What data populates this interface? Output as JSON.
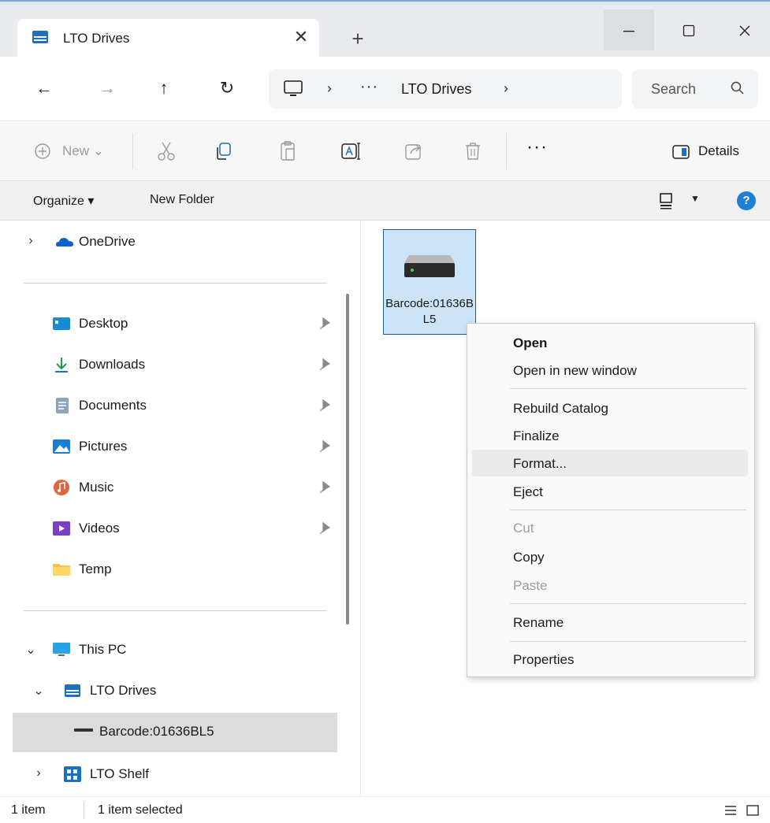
{
  "window": {
    "tab_title": "LTO Drives",
    "tab_close": "✕",
    "new_tab": "+",
    "minimize": "—",
    "maximize": "☐",
    "close": "✕"
  },
  "nav": {
    "back": "←",
    "forward": "→",
    "up": "↑",
    "refresh": "↻",
    "breadcrumb_sep": "›",
    "breadcrumb_overflow": "···",
    "breadcrumb_current": "LTO Drives",
    "search_placeholder": "Search"
  },
  "command_bar": {
    "new_label": "New ⌄",
    "more": "···",
    "details_label": "Details"
  },
  "organize_bar": {
    "organize_label": "Organize ▾",
    "new_folder_label": "New Folder",
    "view_caret": "▼",
    "help": "?"
  },
  "sidebar": {
    "onedrive": "OneDrive",
    "quick_access": [
      {
        "label": "Desktop",
        "icon": "desktop-icon"
      },
      {
        "label": "Downloads",
        "icon": "downloads-icon"
      },
      {
        "label": "Documents",
        "icon": "documents-icon"
      },
      {
        "label": "Pictures",
        "icon": "pictures-icon"
      },
      {
        "label": "Music",
        "icon": "music-icon"
      },
      {
        "label": "Videos",
        "icon": "videos-icon"
      },
      {
        "label": "Temp",
        "icon": "folder-icon"
      }
    ],
    "this_pc": "This PC",
    "lto_drives": "LTO Drives",
    "barcode_item": "Barcode:01636BL5",
    "lto_shelf": "LTO Shelf",
    "chevron_right": "›",
    "chevron_down": "⌄"
  },
  "content": {
    "file_name": "Barcode:01636BL5"
  },
  "context_menu": {
    "items": [
      {
        "label": "Open",
        "style": "bold"
      },
      {
        "label": "Open in new window",
        "style": "normal"
      },
      {
        "label": "Rebuild Catalog",
        "style": "normal"
      },
      {
        "label": "Finalize",
        "style": "normal"
      },
      {
        "label": "Format...",
        "style": "hover"
      },
      {
        "label": "Eject",
        "style": "normal"
      },
      {
        "label": "Cut",
        "style": "disabled"
      },
      {
        "label": "Copy",
        "style": "normal"
      },
      {
        "label": "Paste",
        "style": "disabled"
      },
      {
        "label": "Rename",
        "style": "normal"
      },
      {
        "label": "Properties",
        "style": "normal"
      }
    ]
  },
  "status_bar": {
    "item_count": "1 item",
    "selection": "1 item selected"
  },
  "colors": {
    "accent": "#1f7fd6",
    "selection_fill": "#cce4f7",
    "selection_border": "#1e5d93"
  }
}
